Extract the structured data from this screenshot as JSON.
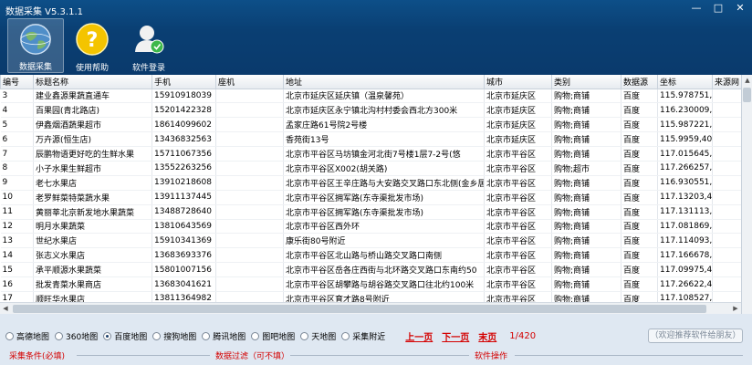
{
  "window": {
    "title": "数据采集 V5.3.1.1",
    "min": "—",
    "max": "□",
    "close": "✕"
  },
  "toolbar": [
    {
      "label": "数据采集",
      "icon": "globe-icon",
      "active": true
    },
    {
      "label": "使用帮助",
      "icon": "help-icon",
      "active": false
    },
    {
      "label": "软件登录",
      "icon": "user-icon",
      "active": false
    }
  ],
  "table": {
    "columns": [
      "编号",
      "标题名称",
      "手机",
      "座机",
      "地址",
      "城市",
      "类别",
      "数据源",
      "坐标",
      "来源网"
    ],
    "rows": [
      [
        "3",
        "建业鑫源果蔬直通车",
        "15910918039",
        "",
        "北京市延庆区延庆镇（温泉馨苑）",
        "北京市延庆区",
        "购物;商铺",
        "百度",
        "115.978751,40",
        ""
      ],
      [
        "4",
        "百果园(青北路店)",
        "15201422328",
        "",
        "北京市延庆区永宁镇北沟村村委会西北方300米",
        "北京市延庆区",
        "购物;商铺",
        "百度",
        "116.230009,40",
        ""
      ],
      [
        "5",
        "伊鑫烟酒蔬果超市",
        "18614099602",
        "",
        "孟家庄路61号院2号楼",
        "北京市延庆区",
        "购物;商铺",
        "百度",
        "115.987221,40",
        ""
      ],
      [
        "6",
        "万卉源(恒生店)",
        "13436832563",
        "",
        "香苑街13号",
        "北京市延庆区",
        "购物;商铺",
        "百度",
        "115.9959,40.4",
        ""
      ],
      [
        "7",
        "辰鹏物语更好吃的生鲜水果",
        "15711067356",
        "",
        "北京市平谷区马坊镇金河北街7号楼1层7-2号(悠",
        "北京市平谷区",
        "购物;商铺",
        "百度",
        "117.015645,40",
        ""
      ],
      [
        "8",
        "小子水果生鲜超市",
        "13552263256",
        "",
        "北京市平谷区X002(胡关路)",
        "北京市平谷区",
        "购物;超市",
        "百度",
        "117.266257,40",
        ""
      ],
      [
        "9",
        "老七水果店",
        "13910218608",
        "",
        "北京市平谷区王辛庄路与大安路交叉路口东北侧(金乡居",
        "北京市平谷区",
        "购物;商铺",
        "百度",
        "116.930551,40",
        ""
      ],
      [
        "10",
        "老罗鲜菜特菜蔬水果",
        "13911137445",
        "",
        "北京市平谷区拥军路(东寺渠批发市场)",
        "北京市平谷区",
        "购物;商铺",
        "百度",
        "117.13203,40.1",
        ""
      ],
      [
        "11",
        "黄丽莘北京新发地水果蔬菜",
        "13488728640",
        "",
        "北京市平谷区拥军路(东寺渠批发市场)",
        "北京市平谷区",
        "购物;商铺",
        "百度",
        "117.131113,40",
        ""
      ],
      [
        "12",
        "明月水果蔬菜",
        "13810643569",
        "",
        "北京市平谷区西外环",
        "北京市平谷区",
        "购物;商铺",
        "百度",
        "117.081869,40",
        ""
      ],
      [
        "13",
        "世纪水果店",
        "15910341369",
        "",
        "康乐街80号附近",
        "北京市平谷区",
        "购物;商铺",
        "百度",
        "117.114093,40",
        ""
      ],
      [
        "14",
        "张志义水果店",
        "13683693376",
        "",
        "北京市平谷区北山路与桥山路交叉路口南侧",
        "北京市平谷区",
        "购物;商铺",
        "百度",
        "117.166678,40",
        ""
      ],
      [
        "15",
        "承平顺源水果蔬菜",
        "15801007156",
        "",
        "北京市平谷区岳各庄西街与北环路交叉路口东南约50",
        "北京市平谷区",
        "购物;商铺",
        "百度",
        "117.09975,40.",
        ""
      ],
      [
        "16",
        "批发青菜水果商店",
        "13683041621",
        "",
        "北京市平谷区胡攀路与胡谷路交叉路口往北约100米",
        "北京市平谷区",
        "购物;商铺",
        "百度",
        "117.26622,40.",
        ""
      ],
      [
        "17",
        "顺旺华水果店",
        "13811364982",
        "",
        "北京市平谷区育才路8号附近",
        "北京市平谷区",
        "购物;商铺",
        "百度",
        "117.108527,40",
        ""
      ]
    ]
  },
  "maps": {
    "options": [
      "高德地图",
      "360地图",
      "百度地图",
      "搜狗地图",
      "腾讯地图",
      "图吧地图",
      "天地图",
      "采集附近"
    ],
    "selected": "百度地图"
  },
  "pager": {
    "prev": "上一页",
    "next": "下一页",
    "last": "末页",
    "count": "1/420"
  },
  "recommend": "（欢迎推荐软件给朋友）",
  "sections": {
    "conditions": "采集条件(必填)",
    "filter": "数据过滤（可不填）",
    "ops": "软件操作"
  },
  "colors": {
    "header": "#0a3f73",
    "accent": "#d40000",
    "selected_row": "#d6e6f7"
  }
}
